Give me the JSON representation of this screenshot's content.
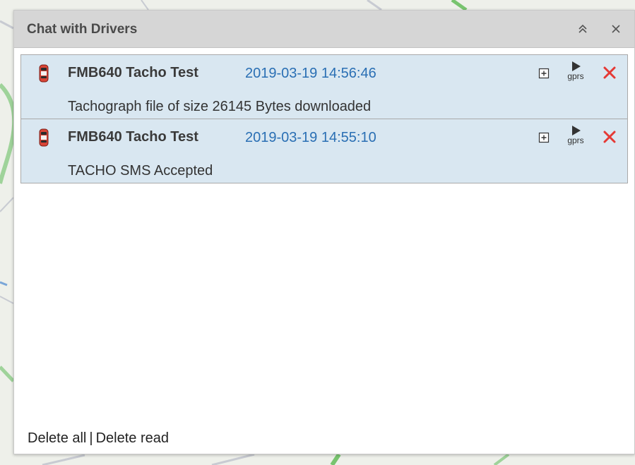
{
  "panel": {
    "title": "Chat with Drivers"
  },
  "messages": [
    {
      "name": "FMB640 Tacho Test",
      "time": "2019-03-19 14:56:46",
      "text": "Tachograph file of size 26145 Bytes downloaded",
      "gprs_label": "gprs"
    },
    {
      "name": "FMB640 Tacho Test",
      "time": "2019-03-19 14:55:10",
      "text": "TACHO SMS Accepted",
      "gprs_label": "gprs"
    }
  ],
  "footer": {
    "delete_all": "Delete all",
    "separator": "|",
    "delete_read": "Delete read"
  },
  "colors": {
    "header_bg": "#d6d6d6",
    "message_bg": "#d9e7f1",
    "timestamp": "#2a6fb4",
    "delete_icon": "#e53935"
  },
  "icons": {
    "collapse": "double-chevron-up-icon",
    "close": "close-icon",
    "vehicle": "car-icon",
    "expand": "plus-square-icon",
    "send": "play-icon",
    "delete": "red-x-icon"
  }
}
